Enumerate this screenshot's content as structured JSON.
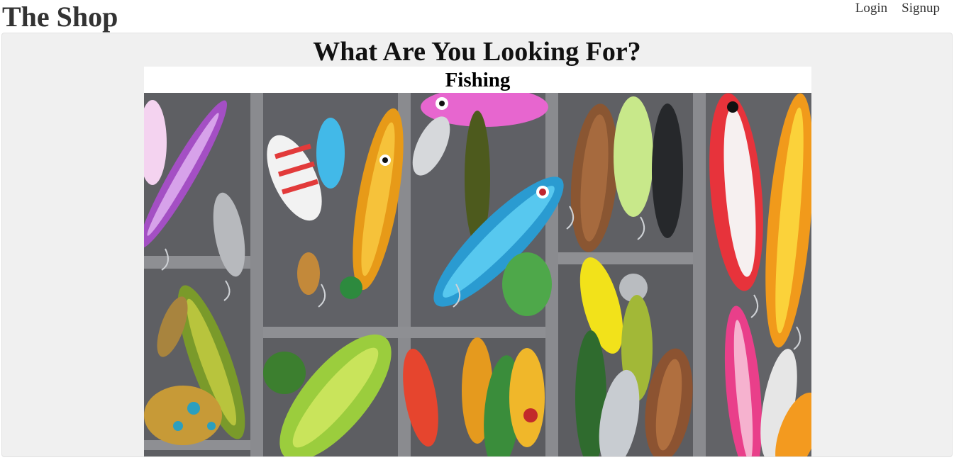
{
  "header": {
    "brand": "The Shop",
    "nav": {
      "login": "Login",
      "signup": "Signup"
    }
  },
  "main": {
    "heading": "What Are You Looking For?",
    "category": {
      "title": "Fishing",
      "image_subject": "fishing lures in tackle box"
    }
  }
}
